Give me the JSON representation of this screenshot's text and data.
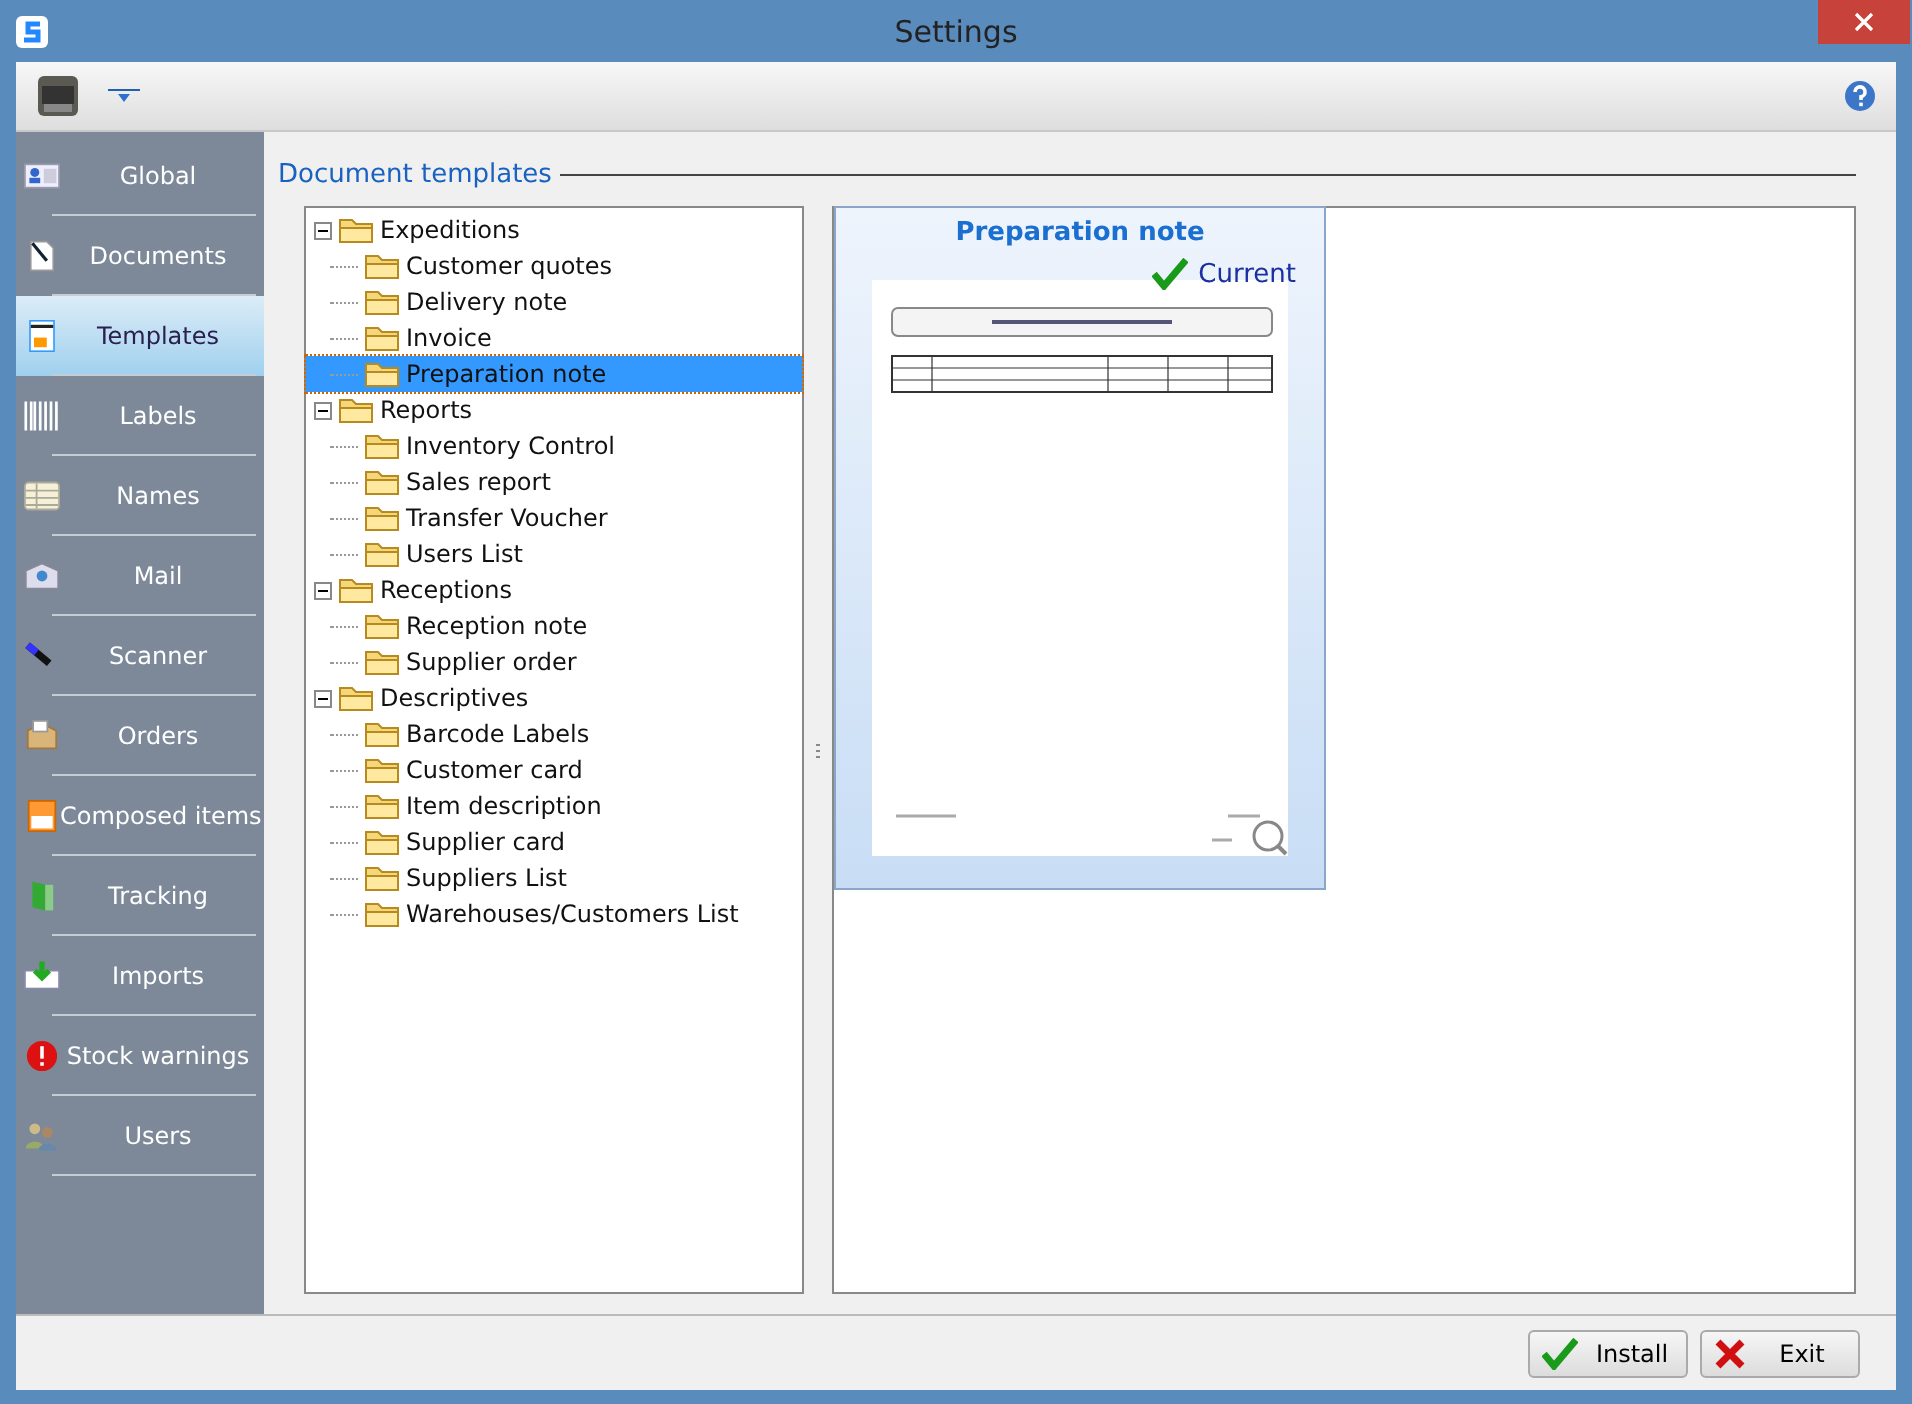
{
  "window": {
    "title": "Settings"
  },
  "sidebar": {
    "items": [
      {
        "label": "Global",
        "selected": false
      },
      {
        "label": "Documents",
        "selected": false
      },
      {
        "label": "Templates",
        "selected": true
      },
      {
        "label": "Labels",
        "selected": false
      },
      {
        "label": "Names",
        "selected": false
      },
      {
        "label": "Mail",
        "selected": false
      },
      {
        "label": "Scanner",
        "selected": false
      },
      {
        "label": "Orders",
        "selected": false
      },
      {
        "label": "Composed items",
        "selected": false
      },
      {
        "label": "Tracking",
        "selected": false
      },
      {
        "label": "Imports",
        "selected": false
      },
      {
        "label": "Stock warnings",
        "selected": false
      },
      {
        "label": "Users",
        "selected": false
      }
    ]
  },
  "section_title": "Document templates",
  "tree": [
    {
      "label": "Expeditions",
      "expanded": true,
      "children": [
        {
          "label": "Customer quotes",
          "selected": false
        },
        {
          "label": "Delivery note",
          "selected": false
        },
        {
          "label": "Invoice",
          "selected": false
        },
        {
          "label": "Preparation note",
          "selected": true
        }
      ]
    },
    {
      "label": "Reports",
      "expanded": true,
      "children": [
        {
          "label": "Inventory Control",
          "selected": false
        },
        {
          "label": "Sales report",
          "selected": false
        },
        {
          "label": "Transfer Voucher",
          "selected": false
        },
        {
          "label": "Users List",
          "selected": false
        }
      ]
    },
    {
      "label": "Receptions",
      "expanded": true,
      "children": [
        {
          "label": "Reception note",
          "selected": false
        },
        {
          "label": "Supplier order",
          "selected": false
        }
      ]
    },
    {
      "label": "Descriptives",
      "expanded": true,
      "children": [
        {
          "label": "Barcode Labels",
          "selected": false
        },
        {
          "label": "Customer card",
          "selected": false
        },
        {
          "label": "Item description",
          "selected": false
        },
        {
          "label": "Supplier card",
          "selected": false
        },
        {
          "label": "Suppliers List",
          "selected": false
        },
        {
          "label": "Warehouses/Customers List",
          "selected": false
        }
      ]
    }
  ],
  "preview": {
    "title": "Preparation note",
    "status": "Current",
    "current": true
  },
  "buttons": [
    {
      "label": "Install",
      "kind": "ok"
    },
    {
      "label": "Exit",
      "kind": "cancel"
    }
  ]
}
